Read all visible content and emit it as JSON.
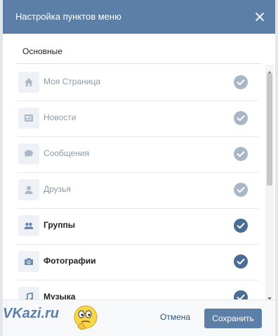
{
  "dialog": {
    "title": "Настройка пунктов меню",
    "close_icon": "close-icon"
  },
  "tabs": [
    {
      "label": "Основные"
    }
  ],
  "menu_items": [
    {
      "label": "Моя Страница",
      "icon": "home-icon",
      "enabled": false
    },
    {
      "label": "Новости",
      "icon": "news-icon",
      "enabled": false
    },
    {
      "label": "Сообщения",
      "icon": "message-icon",
      "enabled": false
    },
    {
      "label": "Друзья",
      "icon": "friend-icon",
      "enabled": false
    },
    {
      "label": "Группы",
      "icon": "groups-icon",
      "enabled": true
    },
    {
      "label": "Фотографии",
      "icon": "camera-icon",
      "enabled": true
    },
    {
      "label": "Музыка",
      "icon": "music-icon",
      "enabled": true
    }
  ],
  "footer": {
    "cancel_label": "Отмена",
    "save_label": "Сохранить",
    "watermark": "VKazi.ru"
  },
  "colors": {
    "header": "#5b7fa6",
    "check_enabled": "#4a6d95",
    "check_disabled": "#a8b6c6"
  }
}
